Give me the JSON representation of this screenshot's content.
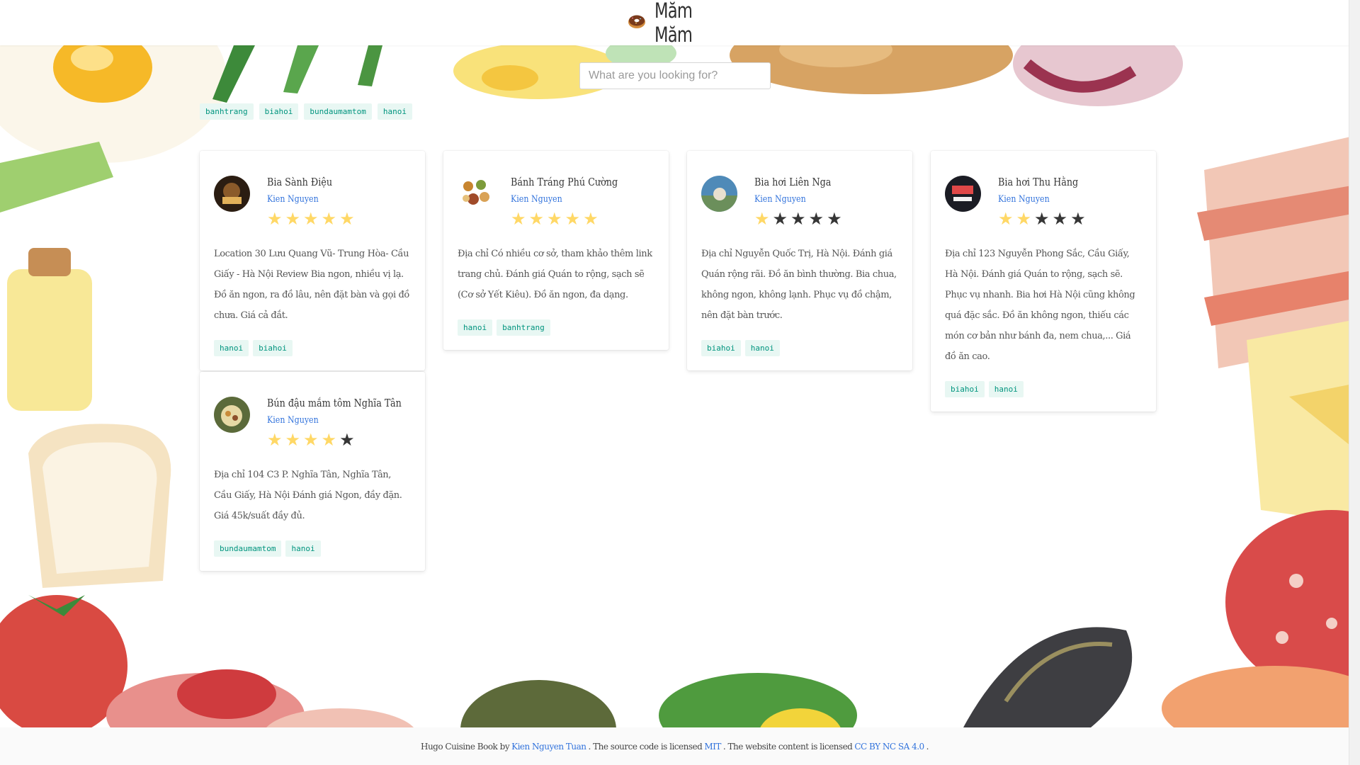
{
  "brand": {
    "name": "Măm Măm",
    "icon": "donut-icon"
  },
  "search": {
    "placeholder": "What are you looking for?"
  },
  "tag_filters": [
    "banhtrang",
    "biahoi",
    "bundaumamtom",
    "hanoi"
  ],
  "colors": {
    "accent": "#3273dc",
    "tag_bg": "#e8f7f3",
    "tag_text": "#00947e",
    "star_on": "#ffd866",
    "star_off": "#363636"
  },
  "cards": [
    {
      "title": "Bia Sành Điệu",
      "author": "Kien Nguyen",
      "rating": 5,
      "description": "Location 30 Lưu Quang Vũ- Trung Hòa- Cầu Giấy - Hà Nội Review Bia ngon, nhiều vị lạ. Đồ ăn ngon, ra đồ lâu, nên đặt bàn và gọi đồ chưa. Giá cả đắt.",
      "tags": [
        "hanoi",
        "biahoi"
      ]
    },
    {
      "title": "Bánh Tráng Phú Cường",
      "author": "Kien Nguyen",
      "rating": 5,
      "description": "Địa chỉ Có nhiều cơ sở, tham khảo thêm link trang chủ. Đánh giá Quán to rộng, sạch sẽ (Cơ sở Yết Kiêu). Đồ ăn ngon, đa dạng.",
      "tags": [
        "hanoi",
        "banhtrang"
      ]
    },
    {
      "title": "Bia hơi Liên Nga",
      "author": "Kien Nguyen",
      "rating": 1,
      "description": "Địa chỉ Nguyễn Quốc Trị, Hà Nội. Đánh giá Quán rộng rãi. Đồ ăn bình thường. Bia chua, không ngon, không lạnh. Phục vụ đồ chậm, nên đặt bàn trước.",
      "tags": [
        "biahoi",
        "hanoi"
      ]
    },
    {
      "title": "Bia hơi Thu Hằng",
      "author": "Kien Nguyen",
      "rating": 2,
      "description": "Địa chỉ 123 Nguyễn Phong Sắc, Cầu Giấy, Hà Nội. Đánh giá Quán to rộng, sạch sẽ. Phục vụ nhanh. Bia hơi Hà Nội cũng không quá đặc sắc. Đồ ăn không ngon, thiếu các món cơ bản như bánh đa, nem chua,... Giá đồ ăn cao.",
      "tags": [
        "biahoi",
        "hanoi"
      ]
    },
    {
      "title": "Bún đậu mắm tôm Nghĩa Tân",
      "author": "Kien Nguyen",
      "rating": 4,
      "description": "Địa chỉ 104 C3 P. Nghĩa Tân, Nghĩa Tân, Cầu Giấy, Hà Nội Đánh giá Ngon, đầy đặn. Giá 45k/suất đầy đủ.",
      "tags": [
        "bundaumamtom",
        "hanoi"
      ]
    }
  ],
  "footer": {
    "prefix": "Hugo Cuisine Book by",
    "author_link": "Kien Nguyen Tuan",
    "mid1": ". The source code is licensed",
    "code_license": "MIT",
    "mid2": ". The website content is licensed",
    "content_license": "CC BY NC SA 4.0",
    "suffix": "."
  }
}
